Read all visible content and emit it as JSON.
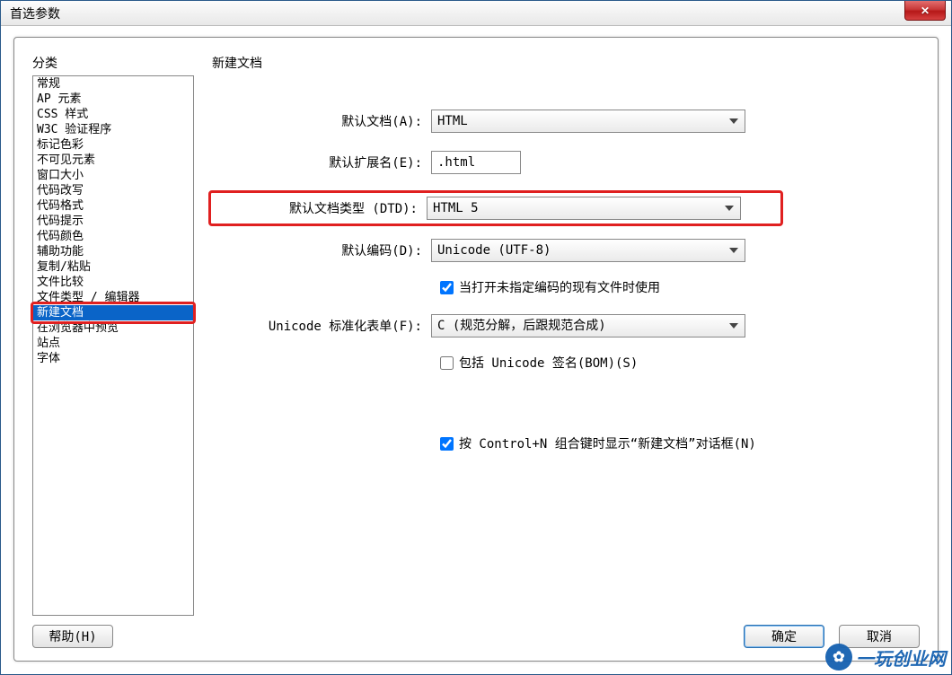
{
  "window": {
    "title": "首选参数"
  },
  "left": {
    "header": "分类",
    "items": [
      "常规",
      "AP 元素",
      "CSS 样式",
      "W3C 验证程序",
      "标记色彩",
      "不可见元素",
      "窗口大小",
      "代码改写",
      "代码格式",
      "代码提示",
      "代码颜色",
      "辅助功能",
      "复制/粘贴",
      "文件比较",
      "文件类型 / 编辑器",
      "新建文档",
      "在浏览器中预览",
      "站点",
      "字体"
    ],
    "selected_index": 15
  },
  "right": {
    "header": "新建文档",
    "labels": {
      "default_doc": "默认文档(A):",
      "default_ext": "默认扩展名(E):",
      "default_dtd": "默认文档类型 (DTD):",
      "default_enc": "默认编码(D):",
      "unicode_form": "Unicode 标准化表单(F):"
    },
    "values": {
      "default_doc": "HTML",
      "default_ext": ".html",
      "default_dtd": "HTML 5",
      "default_enc": "Unicode (UTF-8)",
      "unicode_form": "C (规范分解，后跟规范合成)"
    },
    "checkboxes": {
      "use_when_open": {
        "label": "当打开未指定编码的现有文件时使用",
        "checked": true
      },
      "include_bom": {
        "label": "包括 Unicode 签名(BOM)(S)",
        "checked": false
      },
      "show_on_ctrl_n": {
        "label": "按 Control+N 组合键时显示“新建文档”对话框(N)",
        "checked": true
      }
    }
  },
  "buttons": {
    "help": "帮助(H)",
    "ok": "确定",
    "cancel": "取消"
  },
  "watermark": "一玩创业网"
}
